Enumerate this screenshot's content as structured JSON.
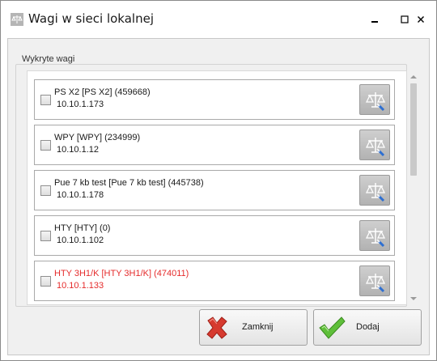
{
  "window": {
    "title": "Wagi w sieci lokalnej"
  },
  "group": {
    "legend": "Wykryte wagi"
  },
  "devices": [
    {
      "name": "PS X2 [PS X2] (459668)",
      "ip": "10.10.1.173",
      "error": false
    },
    {
      "name": "WPY [WPY] (234999)",
      "ip": "10.10.1.12",
      "error": false
    },
    {
      "name": "Pue 7 kb test [Pue 7 kb test] (445738)",
      "ip": "10.10.1.178",
      "error": false
    },
    {
      "name": "HTY [HTY] (0)",
      "ip": "10.10.1.102",
      "error": false
    },
    {
      "name": "HTY 3H1/K [HTY 3H1/K] (474011)",
      "ip": "10.10.1.133",
      "error": true
    }
  ],
  "buttons": {
    "close_label": "Zamknij",
    "add_label": "Dodaj"
  },
  "colors": {
    "error_text": "#e52b2b",
    "accent_close": "#d63a2f",
    "accent_add": "#5fbf3a"
  },
  "icons": {
    "app": "scale-app-icon",
    "device_action": "scale-settings-icon",
    "close": "red-x-icon",
    "add": "green-checkmark-icon"
  }
}
